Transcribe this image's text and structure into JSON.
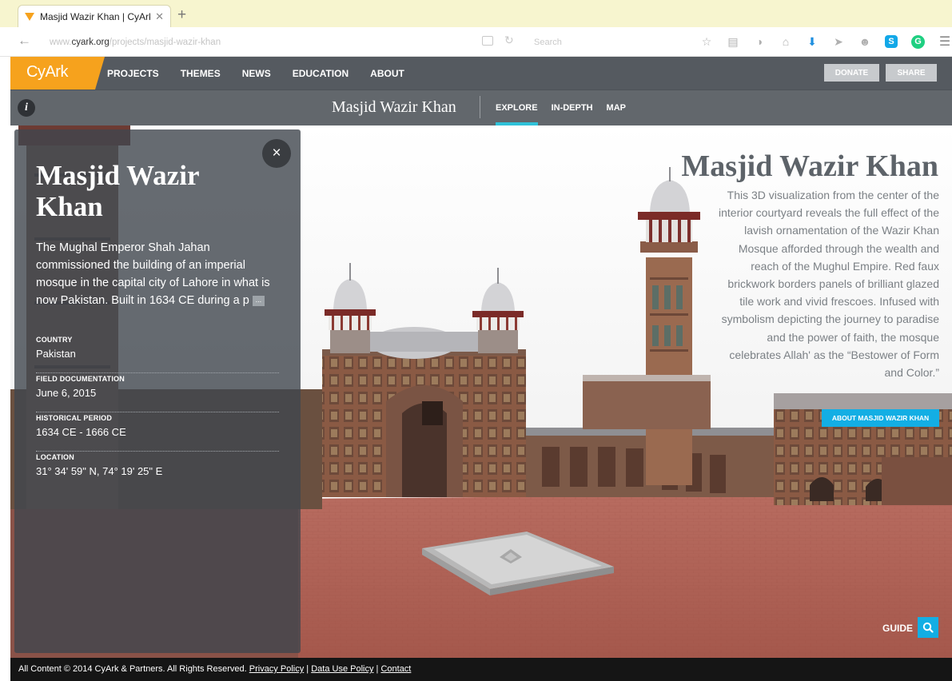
{
  "browser": {
    "tab_title": "Masjid Wazir Khan | CyArk",
    "tab_close": "✕",
    "new_tab": "+",
    "url_prefix": "www.",
    "url_host": "cyark.org",
    "url_path": "/projects/masjid-wazir-khan",
    "search_placeholder": "Search"
  },
  "site": {
    "logo": "CyArk",
    "nav": [
      "PROJECTS",
      "THEMES",
      "NEWS",
      "EDUCATION",
      "ABOUT"
    ],
    "donate": "DONATE",
    "share": "SHARE"
  },
  "subheader": {
    "info": "i",
    "title": "Masjid Wazir Khan",
    "tabs": [
      "EXPLORE",
      "IN-DEPTH",
      "MAP"
    ],
    "active_tab": "EXPLORE"
  },
  "panel": {
    "close": "×",
    "title": "Masjid Wazir Khan",
    "description": "The Mughal Emperor Shah Jahan commissioned the building of an imperial mosque in the capital city of Lahore in what is now Pakistan. Built in 1634 CE during a p",
    "more": "...",
    "facts": [
      {
        "label": "COUNTRY",
        "value": "Pakistan"
      },
      {
        "label": "FIELD DOCUMENTATION",
        "value": "June 6, 2015"
      },
      {
        "label": "HISTORICAL PERIOD",
        "value": "1634 CE - 1666 CE"
      },
      {
        "label": "LOCATION",
        "value": "31° 34' 59\" N, 74° 19' 25\" E"
      }
    ]
  },
  "hero": {
    "title": "Masjid Wazir Khan",
    "description": "This 3D visualization from the center of the interior courtyard reveals the full effect of the lavish ornamentation of the Wazir Khan Mosque afforded through the wealth and reach of the Mughul Empire. Red faux brickwork borders panels of brilliant glazed tile work and vivid frescoes. Infused with symbolism depicting the journey to paradise and the power of faith, the mosque celebrates Allah' as the “Bestower of Form and Color.”",
    "about_button": "ABOUT MASJID WAZIR KHAN",
    "guide": "GUIDE"
  },
  "footer": {
    "copyright": "All Content © 2014 CyArk & Partners. All Rights Reserved.",
    "links": [
      "Privacy Policy",
      "Data Use Policy",
      "Contact"
    ],
    "separator": "|"
  },
  "colors": {
    "brand_orange": "#f6a21d",
    "accent_blue": "#13aee4",
    "header_gray": "#555a60",
    "active_tab_underline": "#2fc2d9"
  },
  "icons": {
    "favicon": "cyark-favicon-icon",
    "back": "arrow-left-icon",
    "reload": "reload-icon",
    "bookmark": "star-icon",
    "download": "download-icon",
    "menu": "hamburger-menu-icon",
    "guide": "search-icon"
  }
}
